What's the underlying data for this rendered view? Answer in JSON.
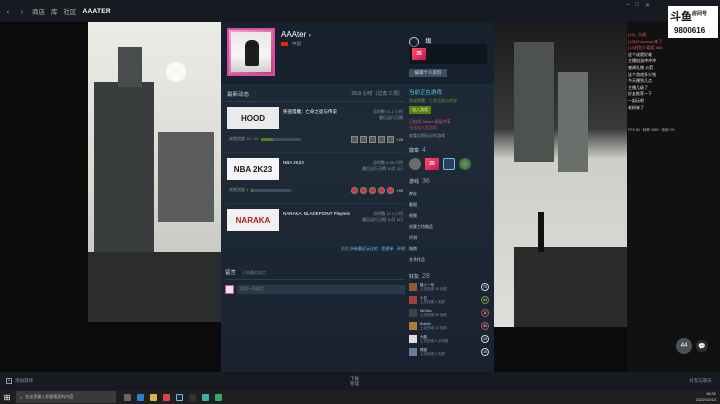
{
  "topbar": {
    "nav": [
      "商店",
      "库",
      "社区",
      "AAATER"
    ],
    "active_index": 3
  },
  "profile": {
    "name": "AAAter",
    "summary_line": "中国",
    "edit_label": "编辑个人资料",
    "level_label": "级",
    "badge_value": "25",
    "recent_title": "最新动态",
    "recent_hours": "28.8 小时（过去 2 周）",
    "games": [
      {
        "title": "HOOD",
        "name": "侠盗猎魔：亡命之徒与传说",
        "stats": "总时数 31.1 小时\n最后运行日期",
        "ach": "成就进度  10 / 34",
        "ach_pct": 0.29,
        "more": "+26"
      },
      {
        "title": "NBA 2K23",
        "name": "NBA 2K23",
        "stats": "总时数 4.98 小时\n最后运行日期 10月 2日",
        "ach": "成就进度  1",
        "ach_pct": 0.05,
        "more": "+90"
      },
      {
        "title": "NARAKA",
        "name": "NARAKA: BLADEPOINT Playtest",
        "stats": "总时数 11.4 小时\n最后运行日期 10月 6日",
        "ach": "",
        "ach_pct": 0,
        "more": ""
      }
    ],
    "recent_footer_prefix": "浏览 ",
    "recent_footer_links": "所有最近玩过的 · 愿望单 · 评测",
    "comments_title": "留言",
    "comments_sub": "已隐藏的留言",
    "comment_placeholder": "添加一条留言"
  },
  "right_col": {
    "online_title": "当前正在游戏",
    "online_game": "侠盗猎魔：亡命之徒与传说",
    "online_btn": "加入游戏",
    "pink_line": "已启用 Steam 家庭共享",
    "red_line": "无法加入此游戏",
    "grey_line": "查看近期玩过的游戏",
    "badges_label": "徽章",
    "badges_count": "4",
    "games_label": "游戏",
    "games_count": "36",
    "links": [
      "库存",
      "截图",
      "视频",
      "艺术作品",
      "评测",
      "指南",
      "创意工坊物品"
    ],
    "groups_label": "组",
    "groups_count": "1",
    "friends_label": "好友",
    "friends_count": "28",
    "friends": [
      {
        "name": "路人一号",
        "status": "上次在线 10 天前",
        "lvl": "75"
      },
      {
        "name": "小白",
        "status": "上次在线 1 天前",
        "lvl": "44"
      },
      {
        "name": "NiGhtw",
        "status": "上次在线 25 天前",
        "lvl": "11"
      },
      {
        "name": "Bubble",
        "status": "上次在线 14 天前",
        "lvl": "30"
      },
      {
        "name": "大鹏",
        "status": "上次在线 3 小时前",
        "lvl": "19"
      },
      {
        "name": "橘猫",
        "status": "上次在线 2 天前",
        "lvl": "15"
      }
    ]
  },
  "stream": {
    "logo_line1": "斗鱼",
    "logo_line2": "房间号",
    "logo_room": "9800616",
    "chat": [
      {
        "t": "[13]...大佬:",
        "c": "r"
      },
      {
        "t": "[13]ViCoconut 来了",
        "c": "r"
      },
      {
        "t": "[13]钱包小姐姐 666",
        "c": "r"
      },
      {
        "t": "这个成就好难",
        "c": "w"
      },
      {
        "t": "主播加油冲冲冲",
        "c": "w"
      },
      {
        "t": "感谢礼物 火箭",
        "c": "w"
      },
      {
        "t": "这个游戏多少钱",
        "c": "w"
      },
      {
        "t": "今天播到几点",
        "c": "w"
      },
      {
        "t": "主播几级了",
        "c": "w"
      },
      {
        "t": "好友推荐一下",
        "c": "w"
      },
      {
        "t": "一起玩吧",
        "c": "w"
      },
      {
        "t": "老粉来了",
        "c": "w"
      }
    ],
    "stat_line": "FPS 60 · 码率 2650 · 丢帧 0%",
    "viewer_number": "44"
  },
  "steam_bottom": {
    "add_game": "添加游戏",
    "downloads": "下载",
    "downloads_sub": "管理",
    "friends": "好友与聊天"
  },
  "taskbar": {
    "search_placeholder": "在这里输入你要搜索的内容",
    "time": "16:31",
    "date": "2022/10/13"
  }
}
